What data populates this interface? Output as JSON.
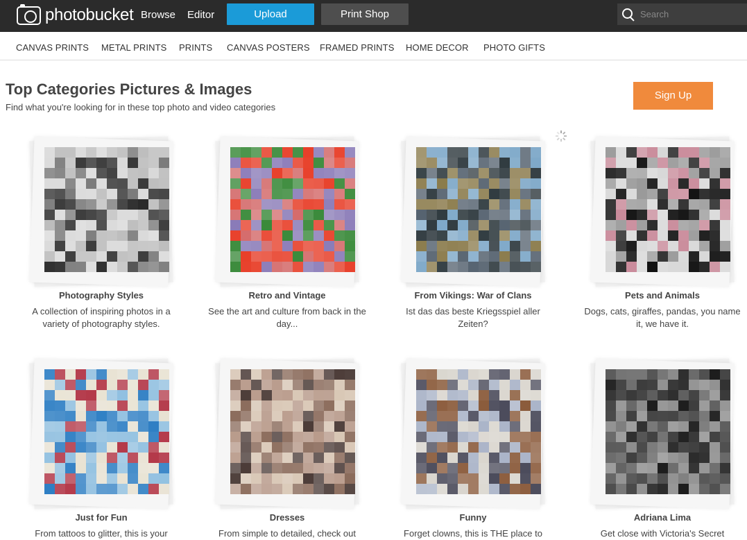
{
  "header": {
    "logo_text": "photobucket",
    "nav": [
      "Browse",
      "Editor"
    ],
    "upload_label": "Upload",
    "print_shop_label": "Print Shop",
    "search_placeholder": "Search"
  },
  "subnav": [
    "CANVAS PRINTS",
    "METAL PRINTS",
    "PRINTS",
    "CANVAS POSTERS",
    "FRAMED PRINTS",
    "HOME DECOR",
    "PHOTO GIFTS"
  ],
  "page": {
    "title": "Top Categories Pictures & Images",
    "subtitle": "Find what you're looking for in these top photo and video categories",
    "signup_label": "Sign Up"
  },
  "categories": [
    {
      "title": "Photography Styles",
      "description": "A collection of inspiring photos in a variety of photography styles.",
      "colors": [
        "#d9d9d9",
        "#7a7a7a",
        "#2a2a2a",
        "#bdbdbd"
      ]
    },
    {
      "title": "Retro and Vintage",
      "description": "See the art and culture from back in the day...",
      "colors": [
        "#e8402a",
        "#8a7bb8",
        "#d46a6a",
        "#3a8a3a"
      ]
    },
    {
      "title": "From  Vikings: War of Clans",
      "description": "Ist das das beste Kriegsspiel aller Zeiten?",
      "colors": [
        "#7fa9c9",
        "#566370",
        "#8a7a4a",
        "#2f3a3f"
      ]
    },
    {
      "title": "Pets and Animals",
      "description": "Dogs, cats, giraffes, pandas, you name it, we have it.",
      "colors": [
        "#111111",
        "#d8d8d8",
        "#9a9a9a",
        "#c98a9a"
      ]
    },
    {
      "title": "Just for Fun",
      "description": "From tattoos to glitter, this is your",
      "colors": [
        "#e8e2d2",
        "#2f7fc4",
        "#b43a4a",
        "#8fbfe0"
      ]
    },
    {
      "title": "Dresses",
      "description": "From simple to detailed, check out",
      "colors": [
        "#d8c6b4",
        "#8a6a5a",
        "#b89a8a",
        "#4a3a36"
      ]
    },
    {
      "title": "Funny",
      "description": "Forget clowns, this is THE place to",
      "colors": [
        "#8a5a3a",
        "#d8d4cc",
        "#4a4a5a",
        "#aab4c8"
      ]
    },
    {
      "title": "Adriana Lima",
      "description": "Get close with Victoria's Secret",
      "colors": [
        "#1a1a1a",
        "#5a5a5a",
        "#8a8a8a",
        "#2e2e2e"
      ]
    }
  ]
}
